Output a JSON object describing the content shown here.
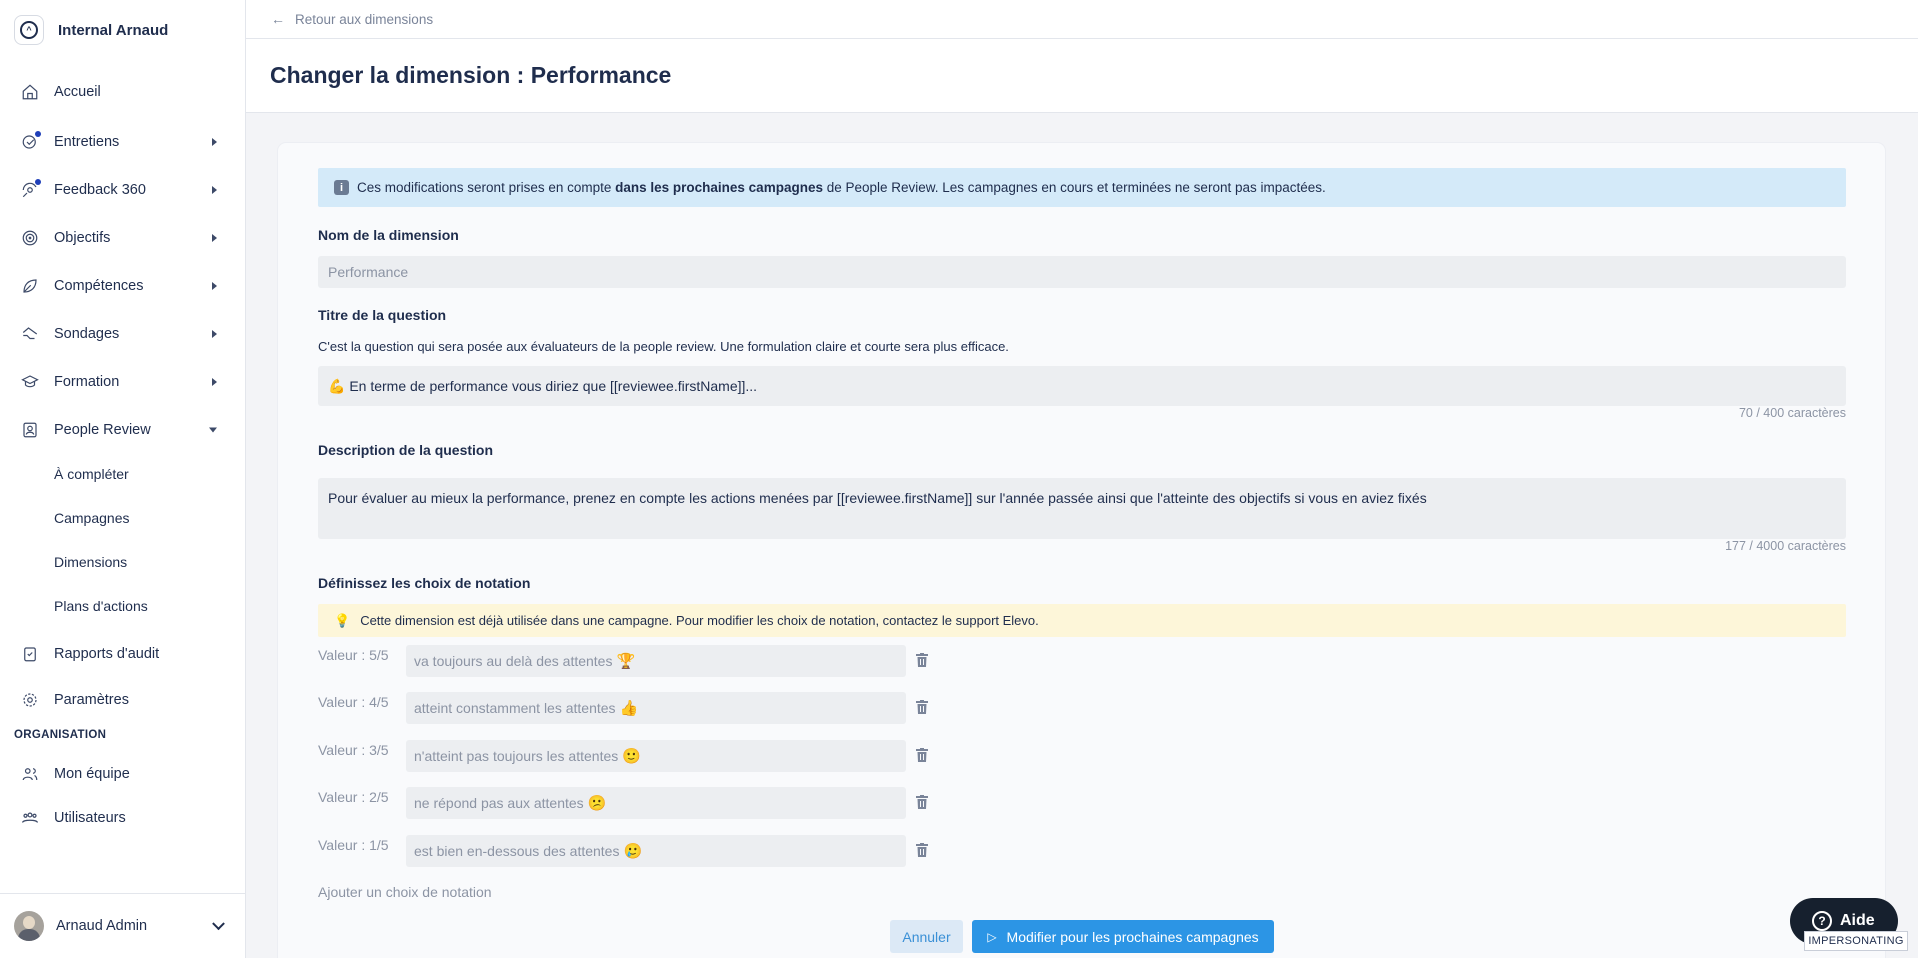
{
  "org": {
    "name": "Internal Arnaud"
  },
  "nav": {
    "home": "Accueil",
    "interviews": "Entretiens",
    "feedback360": "Feedback 360",
    "objectives": "Objectifs",
    "skills": "Compétences",
    "surveys": "Sondages",
    "training": "Formation",
    "people_review": "People Review",
    "sub": [
      "À compléter",
      "Campagnes",
      "Dimensions",
      "Plans d'actions"
    ],
    "audit": "Rapports d'audit",
    "settings": "Paramètres",
    "organisation_section": "ORGANISATION",
    "team": "Mon équipe",
    "users": "Utilisateurs"
  },
  "user": {
    "name": "Arnaud Admin"
  },
  "topbar": {
    "back_label": "Retour aux dimensions"
  },
  "header": {
    "title": "Changer la dimension : Performance"
  },
  "info_banner": {
    "prefix": "Ces modifications seront prises en compte ",
    "bold": "dans les prochaines campagnes",
    "suffix": " de People Review. Les campagnes en cours et terminées ne seront pas impactées."
  },
  "dimension_name": {
    "label": "Nom de la dimension",
    "value": "Performance"
  },
  "question_title": {
    "label": "Titre de la question",
    "help": "C'est la question qui sera posée aux évaluateurs de la people review. Une formulation claire et courte sera plus efficace.",
    "emoji": "💪",
    "value": "En terme de performance vous diriez que [[reviewee.firstName]]...",
    "counter": "70 / 400 caractères"
  },
  "question_description": {
    "label": "Description de la question",
    "value": "Pour évaluer au mieux la performance, prenez en compte les actions menées par [[reviewee.firstName]] sur l'année passée ainsi que l'atteinte des objectifs si vous en aviez fixés",
    "counter": "177 / 4000 caractères"
  },
  "ratings": {
    "label": "Définissez les choix de notation",
    "warning": "Cette dimension est déjà utilisée dans une campagne. Pour modifier les choix de notation, contactez le support Elevo.",
    "choices": [
      {
        "label": "Valeur : 5/5",
        "text": "va toujours au delà des attentes",
        "emoji": "🏆"
      },
      {
        "label": "Valeur : 4/5",
        "text": "atteint constamment les attentes",
        "emoji": "👍"
      },
      {
        "label": "Valeur : 3/5",
        "text": "n'atteint pas toujours les attentes",
        "emoji": "🙂"
      },
      {
        "label": "Valeur : 2/5",
        "text": "ne répond pas aux attentes",
        "emoji": "😕"
      },
      {
        "label": "Valeur : 1/5",
        "text": "est bien en-dessous des attentes",
        "emoji": "🥲"
      }
    ],
    "add_label": "Ajouter un choix de notation"
  },
  "actions": {
    "cancel": "Annuler",
    "submit": "Modifier pour les prochaines campagnes"
  },
  "help_widget": {
    "label": "Aide",
    "badge": "IMPERSONATING"
  }
}
